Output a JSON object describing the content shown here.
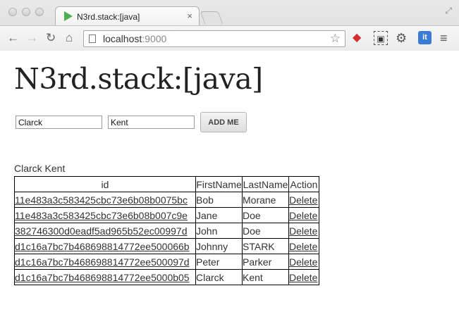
{
  "browser": {
    "tab_title": "N3rd.stack:[java]",
    "tab_close": "×",
    "url_host": "localhost",
    "url_port": ":9000",
    "ext_it_label": "it"
  },
  "page": {
    "title": "N3rd.stack:[java]",
    "form": {
      "first_name_value": "Clarck",
      "last_name_value": "Kent",
      "add_button_label": "ADD ME"
    },
    "last_added": "Clarck Kent",
    "table": {
      "headers": {
        "id": "id",
        "first": "FirstName",
        "last": "LastName",
        "action": "Action"
      },
      "rows": [
        {
          "id": "11e483a3c583425cbc73e6b08b0075bc",
          "first": "Bob",
          "last": "Morane",
          "action": "Delete"
        },
        {
          "id": "11e483a3c583425cbc73e6b08b007c9e",
          "first": "Jane",
          "last": "Doe",
          "action": "Delete"
        },
        {
          "id": "382746300d0eadf5ad965b52ec00997d",
          "first": "John",
          "last": "Doe",
          "action": "Delete"
        },
        {
          "id": "d1c16a7bc7b468698814772ee500066b",
          "first": "Johnny",
          "last": "STARK",
          "action": "Delete"
        },
        {
          "id": "d1c16a7bc7b468698814772ee500097d",
          "first": "Peter",
          "last": "Parker",
          "action": "Delete"
        },
        {
          "id": "d1c16a7bc7b468698814772ee5000b05",
          "first": "Clarck",
          "last": "Kent",
          "action": "Delete"
        }
      ]
    }
  }
}
